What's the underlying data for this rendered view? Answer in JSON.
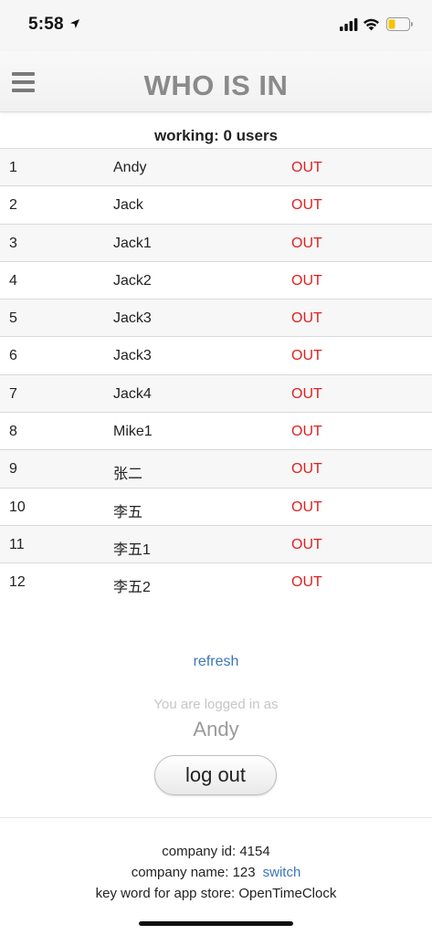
{
  "status_bar": {
    "time": "5:58"
  },
  "header": {
    "title": "WHO IS IN"
  },
  "summary": {
    "working_text": "working: 0 users"
  },
  "users": [
    {
      "num": "1",
      "name": "Andy",
      "status": "OUT"
    },
    {
      "num": "2",
      "name": "Jack",
      "status": "OUT"
    },
    {
      "num": "3",
      "name": "Jack1",
      "status": "OUT"
    },
    {
      "num": "4",
      "name": "Jack2",
      "status": "OUT"
    },
    {
      "num": "5",
      "name": "Jack3",
      "status": "OUT"
    },
    {
      "num": "6",
      "name": "Jack3",
      "status": "OUT"
    },
    {
      "num": "7",
      "name": "Jack4",
      "status": "OUT"
    },
    {
      "num": "8",
      "name": "Mike1",
      "status": "OUT"
    },
    {
      "num": "9",
      "name": "张二",
      "status": "OUT"
    },
    {
      "num": "10",
      "name": "李五",
      "status": "OUT"
    },
    {
      "num": "11",
      "name": "李五1",
      "status": "OUT"
    },
    {
      "num": "12",
      "name": "李五2",
      "status": "OUT"
    }
  ],
  "actions": {
    "refresh_label": "refresh",
    "logged_in_label": "You are logged in as",
    "logged_in_user": "Andy",
    "logout_label": "log out"
  },
  "footer": {
    "company_id": "company id: 4154",
    "company_name": "company name: 123",
    "switch_label": "switch",
    "keyword": "key word for app store: OpenTimeClock"
  },
  "colors": {
    "status_out": "#e02020",
    "link": "#3a76b8",
    "title": "#8a8a8a"
  },
  "icons": [
    "location-arrow-icon",
    "cellular-signal-icon",
    "wifi-icon",
    "battery-icon",
    "menu-icon"
  ]
}
